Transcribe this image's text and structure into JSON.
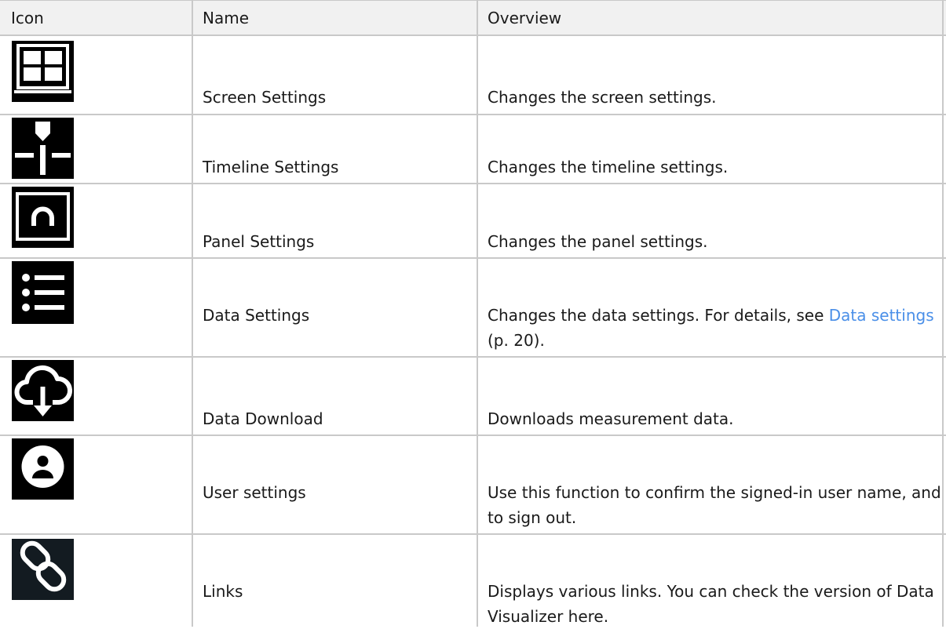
{
  "headers": {
    "icon": "Icon",
    "name": "Name",
    "overview": "Overview"
  },
  "rows": [
    {
      "icon": "screen-settings-icon",
      "name": "Screen Settings",
      "overview": "Changes the screen settings."
    },
    {
      "icon": "timeline-settings-icon",
      "name": "Timeline Settings",
      "overview": "Changes the timeline settings."
    },
    {
      "icon": "panel-settings-icon",
      "name": "Panel Settings",
      "overview": "Changes the panel settings."
    },
    {
      "icon": "data-settings-icon",
      "name": "Data Settings",
      "overview": "Changes the data settings. For details, see ",
      "link": "Data settings",
      "overview_suffix": " (p. 20)."
    },
    {
      "icon": "data-download-icon",
      "name": "Data Download",
      "overview": "Downloads measurement data."
    },
    {
      "icon": "user-settings-icon",
      "name": "User settings",
      "overview": "Use this function to confirm the signed-in user name, and to sign out."
    },
    {
      "icon": "links-icon",
      "name": "Links",
      "overview": "Displays various links. You can check the version of Data Visualizer here."
    }
  ],
  "colors": {
    "link": "#4a8fe8",
    "header_bg": "#f1f1f1",
    "grid": "#c9c9c9",
    "icon_bg": "#000000"
  }
}
